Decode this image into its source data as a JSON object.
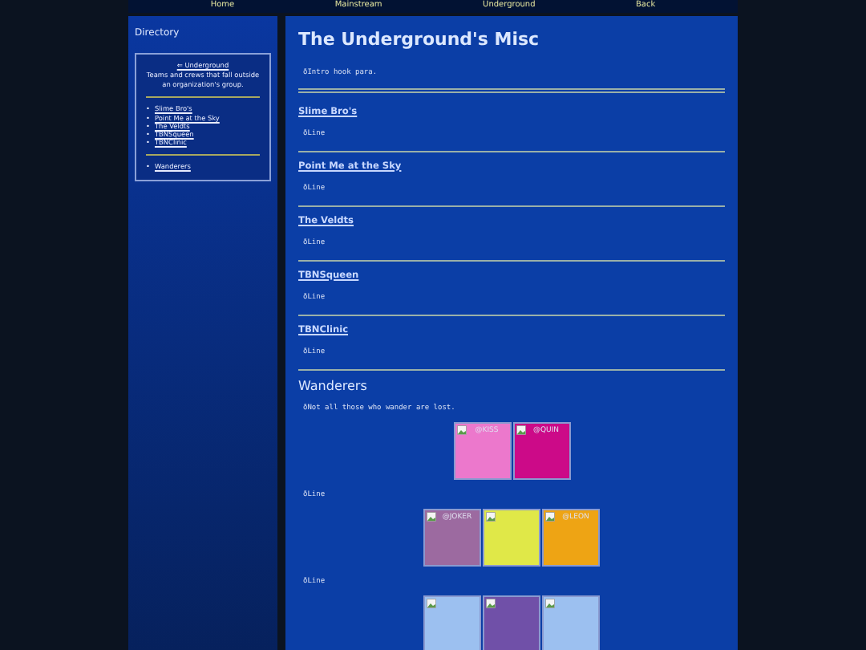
{
  "nav": [
    {
      "label": "Home"
    },
    {
      "label": "Mainstream"
    },
    {
      "label": "Underground"
    },
    {
      "label": "Back"
    }
  ],
  "sidebar": {
    "title": "Directory",
    "back_link": "⇐ Underground",
    "description": "Teams and crews that fall outside an organization's group.",
    "links": [
      {
        "marker": "•",
        "label": "Slime Bro's"
      },
      {
        "marker": "•",
        "label": "Point Me at the Sky"
      },
      {
        "marker": "•",
        "label": "The Veldts"
      },
      {
        "marker": "•",
        "label": "TBNSqueen"
      },
      {
        "marker": "•",
        "label": "TBNClinic"
      }
    ],
    "extra_links": [
      {
        "marker": "•",
        "label": "Wanderers"
      }
    ]
  },
  "main": {
    "title": "The Underground's Misc",
    "intro": "ðIntro hook para.",
    "sections": [
      {
        "link": "Slime Bro's",
        "text": "ðLine"
      },
      {
        "link": "Point Me at the Sky",
        "text": "ðLine"
      },
      {
        "link": "The Veldts",
        "text": "ðLine"
      },
      {
        "link": "TBNSqueen",
        "text": "ðLine"
      },
      {
        "link": "TBNClinic",
        "text": "ðLine"
      }
    ],
    "wanderers": {
      "title": "Wanderers",
      "intro": "ðNot all those who wander are lost.",
      "groups": [
        {
          "tiles": [
            {
              "alt": "@KISS",
              "color": "#ec78cc"
            },
            {
              "alt": "@QUIN",
              "color": "#cc0a88"
            }
          ],
          "text": "ðLine"
        },
        {
          "tiles": [
            {
              "alt": "@JOKER",
              "color": "#9c6aa0"
            },
            {
              "color": "#e0e848"
            },
            {
              "alt": "@LEON",
              "color": "#eea414"
            }
          ],
          "text": "ðLine"
        },
        {
          "tiles": [
            {
              "color": "#9cc0f0"
            },
            {
              "color": "#7050a8"
            },
            {
              "color": "#9cc0f0"
            }
          ]
        }
      ]
    }
  }
}
